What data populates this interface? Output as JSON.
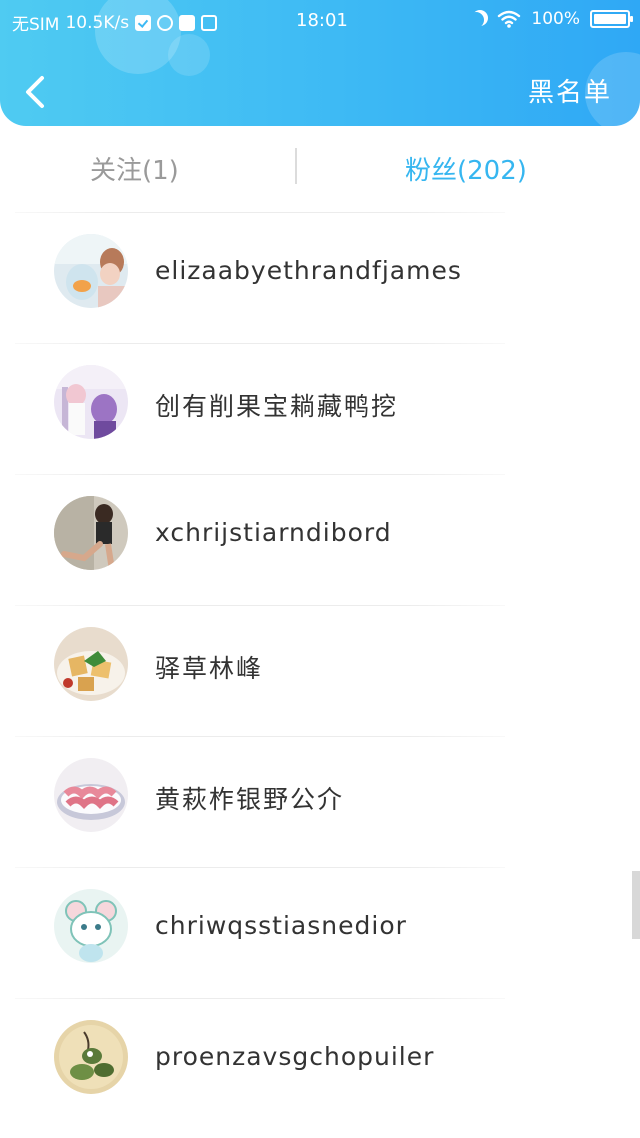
{
  "status_bar": {
    "carrier": "无SIM",
    "speed": "10.5K/s",
    "time": "18:01",
    "battery": "100%"
  },
  "header": {
    "back_icon": "chevron-left-icon",
    "blacklist_label": "黑名单",
    "gradient_start": "#4fcbf2",
    "gradient_end": "#2fa8f5"
  },
  "tabs": {
    "following_label": "关注(1)",
    "fans_label": "粉丝(202)",
    "active": "fans",
    "active_color": "#36b6f0",
    "inactive_color": "#9a9a9a"
  },
  "fans": [
    {
      "name": "elizaabyethrandfjames"
    },
    {
      "name": "创有削果宝耥藏鸭挖"
    },
    {
      "name": "xchrijstiarndibord"
    },
    {
      "name": "驿草林峰"
    },
    {
      "name": "黄萩柞银野公介"
    },
    {
      "name": "chriwqsstiasnedior"
    },
    {
      "name": "proenzavsgchopuiler"
    }
  ]
}
